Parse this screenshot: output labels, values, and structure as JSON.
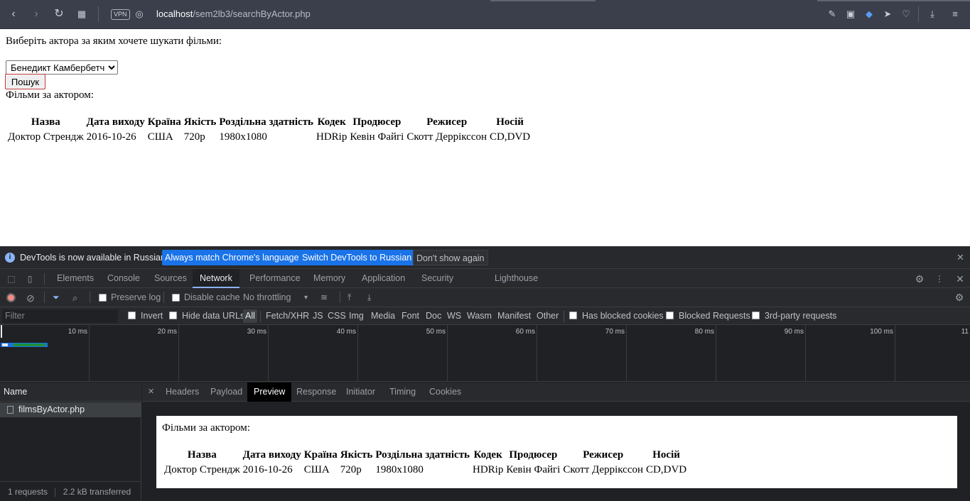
{
  "browser": {
    "url_host": "localhost",
    "url_path": "/sem2lb3/searchByActor.php",
    "vpn_label": "VPN"
  },
  "page": {
    "prompt": "Виберіть актора за яким хочете шукати фільми:",
    "actor_selected": "Бенедикт Камбербетч",
    "search_button": "Пошук",
    "films_heading": "Фільми за актором:",
    "table": {
      "headers": [
        "Назва",
        "Дата виходу",
        "Країна",
        "Якість",
        "Роздільна здатність",
        "Кодек",
        "Продюсер",
        "Режисер",
        "Носій"
      ],
      "rows": [
        [
          "Доктор Стрендж",
          "2016-10-26",
          "США",
          "720p",
          "1980x1080",
          "HDRip",
          "Кевін Файгі",
          "Скотт Деррікссон",
          "CD,DVD"
        ]
      ]
    }
  },
  "devtools": {
    "infobar": {
      "message": "DevTools is now available in Russian!",
      "btn_match": "Always match Chrome's language",
      "btn_switch": "Switch DevTools to Russian",
      "btn_dismiss": "Don't show again"
    },
    "tabs": [
      "Elements",
      "Console",
      "Sources",
      "Network",
      "Performance",
      "Memory",
      "Application",
      "Security",
      "Lighthouse"
    ],
    "active_tab": "Network",
    "toolbar": {
      "preserve_log": "Preserve log",
      "disable_cache": "Disable cache",
      "throttling": "No throttling"
    },
    "filter": {
      "placeholder": "Filter",
      "invert": "Invert",
      "hide_data_urls": "Hide data URLs",
      "types": [
        "All",
        "Fetch/XHR",
        "JS",
        "CSS",
        "Img",
        "Media",
        "Font",
        "Doc",
        "WS",
        "Wasm",
        "Manifest",
        "Other"
      ],
      "has_blocked_cookies": "Has blocked cookies",
      "blocked_requests": "Blocked Requests",
      "third_party": "3rd-party requests"
    },
    "timeline_ticks": [
      "10 ms",
      "20 ms",
      "30 ms",
      "40 ms",
      "50 ms",
      "60 ms",
      "70 ms",
      "80 ms",
      "90 ms",
      "100 ms",
      "11"
    ],
    "request_list": {
      "header": "Name",
      "requests": [
        "filmsByActor.php"
      ],
      "status_requests": "1 requests",
      "status_transferred": "2.2 kB transferred"
    },
    "detail_tabs": [
      "Headers",
      "Payload",
      "Preview",
      "Response",
      "Initiator",
      "Timing",
      "Cookies"
    ],
    "detail_active": "Preview",
    "preview": {
      "films_heading": "Фільми за актором:"
    }
  },
  "colors": {
    "accent": "#1a73e8",
    "record": "#f28b82"
  }
}
